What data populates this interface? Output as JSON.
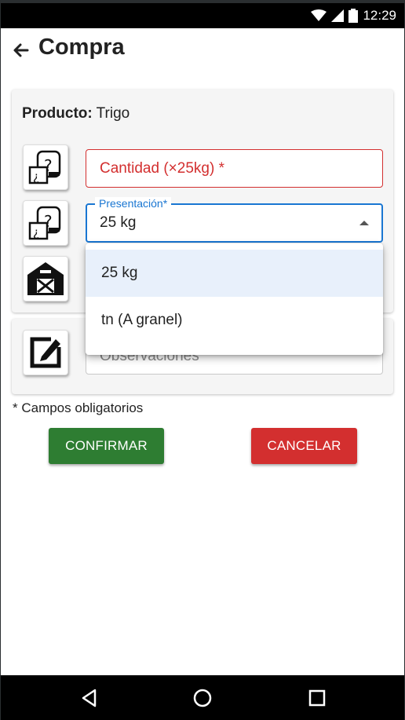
{
  "status_bar": {
    "time": "12:29",
    "icons": [
      "wifi-icon",
      "signal-icon",
      "battery-icon"
    ]
  },
  "app_bar": {
    "back_icon": "arrow-back-icon",
    "title": "Compra"
  },
  "product": {
    "label": "Producto:",
    "value": "Trigo"
  },
  "form": {
    "cantidad": {
      "placeholder": "Cantidad (×25kg) *",
      "icon": "bag-question-icon"
    },
    "presentacion": {
      "label": "Presentación*",
      "value": "25 kg",
      "icon": "bag-question-icon",
      "options": [
        "25 kg",
        "tn (A granel)"
      ],
      "selected_index": 0
    },
    "almacen": {
      "icon": "barn-icon"
    },
    "observaciones": {
      "placeholder": "Observaciones",
      "icon": "edit-note-icon"
    }
  },
  "required_note": "* Campos obligatorios",
  "actions": {
    "confirm_label": "CONFIRMAR",
    "cancel_label": "CANCELAR"
  },
  "colors": {
    "confirm": "#2e7d32",
    "cancel": "#d32f2f",
    "error": "#d32f2f",
    "focus": "#1976d2",
    "selected_option": "#e8f0fb"
  },
  "nav_bar": {
    "icons": [
      "back-triangle-icon",
      "home-circle-icon",
      "recents-square-icon"
    ]
  }
}
